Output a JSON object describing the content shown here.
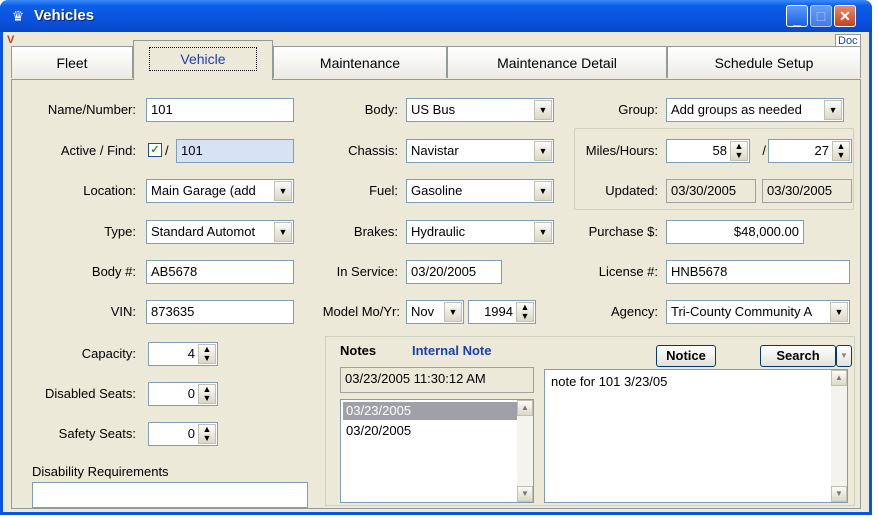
{
  "window": {
    "title": "Vehicles"
  },
  "corner": {
    "left_mark": "V",
    "right_mark": "Doc"
  },
  "tabs": [
    {
      "label": "Fleet"
    },
    {
      "label": "Vehicle"
    },
    {
      "label": "Maintenance"
    },
    {
      "label": "Maintenance Detail"
    },
    {
      "label": "Schedule Setup"
    }
  ],
  "form": {
    "name_number": {
      "label": "Name/Number:",
      "value": "101"
    },
    "active_find": {
      "label": "Active / Find:",
      "checked_glyph": "✓",
      "separator": "/",
      "value": "101"
    },
    "location": {
      "label": "Location:",
      "value": "Main Garage (add"
    },
    "type": {
      "label": "Type:",
      "value": "Standard Automot"
    },
    "body_num": {
      "label": "Body #:",
      "value": "AB5678"
    },
    "vin": {
      "label": "VIN:",
      "value": "873635"
    },
    "capacity": {
      "label": "Capacity:",
      "value": "4"
    },
    "disabled_seats": {
      "label": "Disabled Seats:",
      "value": "0"
    },
    "safety_seats": {
      "label": "Safety Seats:",
      "value": "0"
    },
    "disability_requirements": {
      "label": "Disability Requirements",
      "value": ""
    },
    "body": {
      "label": "Body:",
      "value": "US Bus"
    },
    "chassis": {
      "label": "Chassis:",
      "value": "Navistar"
    },
    "fuel": {
      "label": "Fuel:",
      "value": "Gasoline"
    },
    "brakes": {
      "label": "Brakes:",
      "value": "Hydraulic"
    },
    "in_service": {
      "label": "In Service:",
      "value": "03/20/2005"
    },
    "model_mo_yr": {
      "label": "Model Mo/Yr:",
      "month": "Nov",
      "year": "1994"
    },
    "group": {
      "label": "Group:",
      "value": "Add groups as needed"
    },
    "miles_hours": {
      "label": "Miles/Hours:",
      "miles": "58",
      "separator": "/",
      "hours": "27"
    },
    "updated": {
      "label": "Updated:",
      "date1": "03/30/2005",
      "date2": "03/30/2005"
    },
    "purchase": {
      "label": "Purchase $:",
      "value": "$48,000.00"
    },
    "license": {
      "label": "License #:",
      "value": "HNB5678"
    },
    "agency": {
      "label": "Agency:",
      "value": "Tri-County Community A"
    }
  },
  "notes": {
    "tab_notes": "Notes",
    "tab_internal": "Internal Note",
    "notice_button": "Notice",
    "search_button": "Search",
    "timestamp": "03/23/2005 11:30:12 AM",
    "dates": [
      "03/23/2005",
      "03/20/2005"
    ],
    "note_text": "note for 101 3/23/05"
  },
  "colors": {
    "title_bar": "#0a52de",
    "accent_blue": "#1a3eb4",
    "window_bg": "#ece9d8",
    "selected_item": "#9fa0a8"
  }
}
